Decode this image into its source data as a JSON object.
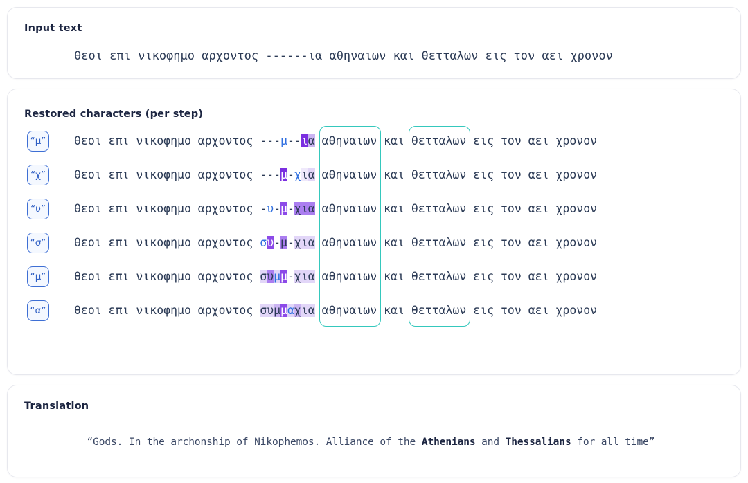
{
  "input_card": {
    "title": "Input text",
    "text": "θεοι επι νικοφημο αρχοντος ------ια αθηναιων και θετταλων εις τον αει χρονον"
  },
  "steps_card": {
    "title": "Restored characters (per step)",
    "prefix": "θεοι επι νικοφημο αρχοντος ",
    "tail": " εις τον αει χρονον",
    "word_athenians": "αθηναιων",
    "word_kai": "και",
    "word_thessalians": "θετταλων",
    "steps": [
      {
        "badge": "“μ”",
        "restored_char": "μ",
        "gap": [
          {
            "c": "-",
            "level": 0,
            "new": false
          },
          {
            "c": "-",
            "level": 0,
            "new": false
          },
          {
            "c": "-",
            "level": 0,
            "new": false
          },
          {
            "c": "μ",
            "level": 0,
            "new": true
          },
          {
            "c": "-",
            "level": 0,
            "new": false
          },
          {
            "c": "-",
            "level": 0,
            "new": false
          },
          {
            "c": "ι",
            "level": 6,
            "new": false
          },
          {
            "c": "α",
            "level": 3,
            "new": false
          }
        ]
      },
      {
        "badge": "“χ”",
        "restored_char": "χ",
        "gap": [
          {
            "c": "-",
            "level": 0,
            "new": false
          },
          {
            "c": "-",
            "level": 0,
            "new": false
          },
          {
            "c": "-",
            "level": 0,
            "new": false
          },
          {
            "c": "μ",
            "level": 6,
            "new": false
          },
          {
            "c": "-",
            "level": 0,
            "new": false
          },
          {
            "c": "χ",
            "level": 0,
            "new": true
          },
          {
            "c": "ι",
            "level": 1,
            "new": false
          },
          {
            "c": "α",
            "level": 2,
            "new": false
          }
        ]
      },
      {
        "badge": "“υ”",
        "restored_char": "υ",
        "gap": [
          {
            "c": "-",
            "level": 0,
            "new": false
          },
          {
            "c": "υ",
            "level": 0,
            "new": true
          },
          {
            "c": "-",
            "level": 0,
            "new": false
          },
          {
            "c": "μ",
            "level": 5,
            "new": false
          },
          {
            "c": "-",
            "level": 0,
            "new": false
          },
          {
            "c": "χ",
            "level": 4,
            "new": false
          },
          {
            "c": "ι",
            "level": 4,
            "new": false
          },
          {
            "c": "α",
            "level": 4,
            "new": false
          }
        ]
      },
      {
        "badge": "“σ”",
        "restored_char": "σ",
        "gap": [
          {
            "c": "σ",
            "level": 0,
            "new": true
          },
          {
            "c": "υ",
            "level": 5,
            "new": false
          },
          {
            "c": "-",
            "level": 0,
            "new": false
          },
          {
            "c": "μ",
            "level": 4,
            "new": false
          },
          {
            "c": "-",
            "level": 0,
            "new": false
          },
          {
            "c": "χ",
            "level": 2,
            "new": false
          },
          {
            "c": "ι",
            "level": 2,
            "new": false
          },
          {
            "c": "α",
            "level": 2,
            "new": false
          }
        ]
      },
      {
        "badge": "“μ”",
        "restored_char": "μ",
        "gap": [
          {
            "c": "σ",
            "level": 2,
            "new": false
          },
          {
            "c": "υ",
            "level": 4,
            "new": false
          },
          {
            "c": "μ",
            "level": 2,
            "new": true
          },
          {
            "c": "μ",
            "level": 5,
            "new": false
          },
          {
            "c": "-",
            "level": 0,
            "new": false
          },
          {
            "c": "χ",
            "level": 2,
            "new": false
          },
          {
            "c": "ι",
            "level": 2,
            "new": false
          },
          {
            "c": "α",
            "level": 2,
            "new": false
          }
        ]
      },
      {
        "badge": "“α”",
        "restored_char": "α",
        "gap": [
          {
            "c": "σ",
            "level": 2,
            "new": false
          },
          {
            "c": "υ",
            "level": 2,
            "new": false
          },
          {
            "c": "μ",
            "level": 3,
            "new": false
          },
          {
            "c": "μ",
            "level": 5,
            "new": false
          },
          {
            "c": "α",
            "level": 2,
            "new": true
          },
          {
            "c": "χ",
            "level": 3,
            "new": false
          },
          {
            "c": "ι",
            "level": 2,
            "new": false
          },
          {
            "c": "α",
            "level": 2,
            "new": false
          }
        ]
      }
    ]
  },
  "translation_card": {
    "title": "Translation",
    "open_quote": "“Gods. In the archonship of Nikophemos. Alliance of the ",
    "bold_1": "Athenians",
    "middle": " and ",
    "bold_2": "Thessalians",
    "close": " for all time”"
  },
  "colors": {
    "card_border": "#e7e8ee",
    "text": "#2b3a55",
    "title": "#1c2541",
    "badge_border": "#3e6fd4",
    "badge_text": "#2f5fc4",
    "new_char": "#2f6fe0",
    "teal_box": "#35c8bd",
    "highlight_strong": "#7b2fe0"
  }
}
